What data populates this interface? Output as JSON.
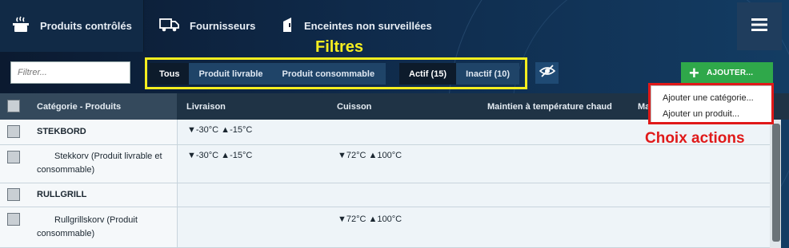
{
  "nav": {
    "tabs": [
      {
        "label": "Produits contrôlés",
        "icon": "cooking-pot-icon",
        "active": true
      },
      {
        "label": "Fournisseurs",
        "icon": "truck-icon",
        "active": false
      },
      {
        "label": "Enceintes non surveillées",
        "icon": "fridge-icon",
        "active": false
      }
    ],
    "menu_icon": "hamburger-menu-icon"
  },
  "toolbar": {
    "filter_placeholder": "Filtrer...",
    "filters": [
      "Tous",
      "Produit livrable",
      "Produit consommable",
      "Actif (15)",
      "Inactif (10)"
    ],
    "visibility_icon": "eye-slash-icon",
    "add_label": "AJOUTER..."
  },
  "annotations": {
    "filtres": "Filtres",
    "choix_actions": "Choix actions"
  },
  "dropdown": {
    "items": [
      "Ajouter une catégorie...",
      "Ajouter un produit..."
    ]
  },
  "table": {
    "headers": [
      "Catégorie - Produits",
      "Livraison",
      "Cuisson",
      "Maintien à température chaud",
      "Ma"
    ],
    "rows": [
      {
        "name": "STEKBORD",
        "livraison": "▼-30°C ▲-15°C",
        "cuisson": ""
      },
      {
        "name": "Stekkorv (Produit livrable et consommable)",
        "livraison": "▼-30°C ▲-15°C",
        "cuisson": "▼72°C ▲100°C"
      },
      {
        "name": "RULLGRILL",
        "livraison": "",
        "cuisson": ""
      },
      {
        "name": "Rullgrillskorv (Produit consommable)",
        "livraison": "",
        "cuisson": "▼72°C ▲100°C"
      }
    ]
  },
  "colors": {
    "accent_green": "#2fa84a",
    "highlight_yellow": "#f5ee1f",
    "highlight_red": "#e01919",
    "nav_dark": "#0b1a30"
  }
}
